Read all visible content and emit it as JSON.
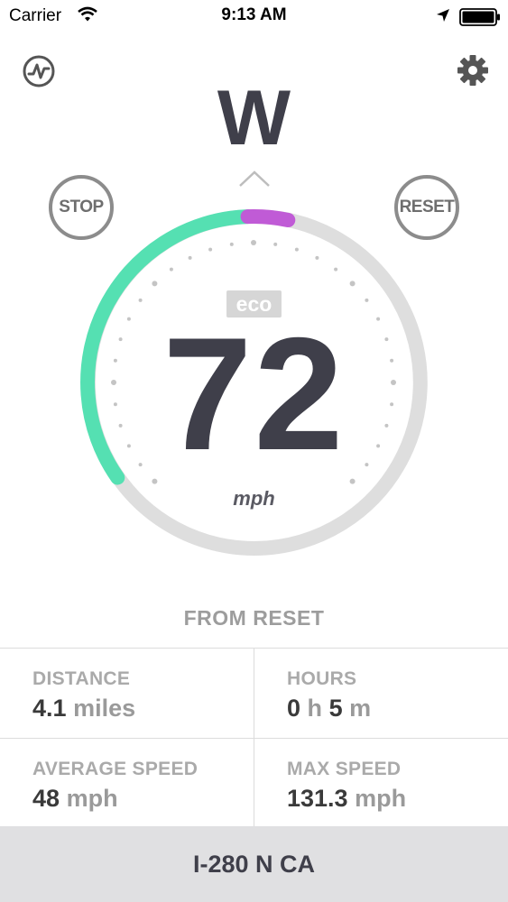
{
  "status_bar": {
    "carrier": "Carrier",
    "time": "9:13 AM"
  },
  "heading": {
    "direction": "W"
  },
  "buttons": {
    "stop": "STOP",
    "reset": "RESET"
  },
  "gauge": {
    "mode_badge": "eco",
    "speed": "72",
    "unit": "mph",
    "colors": {
      "eco": "#55e0b2",
      "over": "#c05bd6",
      "track": "#dedede",
      "ticks": "#c4c4c4"
    }
  },
  "stats": {
    "title": "FROM RESET",
    "distance": {
      "label": "DISTANCE",
      "value": "4.1",
      "unit": "miles"
    },
    "hours": {
      "label": "HOURS",
      "h_value": "0",
      "h_unit": "h",
      "m_value": "5",
      "m_unit": "m"
    },
    "average_speed": {
      "label": "AVERAGE SPEED",
      "value": "48",
      "unit": "mph"
    },
    "max_speed": {
      "label": "MAX SPEED",
      "value": "131.3",
      "unit": "mph"
    }
  },
  "road": {
    "name": "I-280 N CA"
  },
  "icons": {
    "trip": "trip-graph-icon",
    "settings": "gear-icon",
    "direction": "chevron-up-icon"
  }
}
